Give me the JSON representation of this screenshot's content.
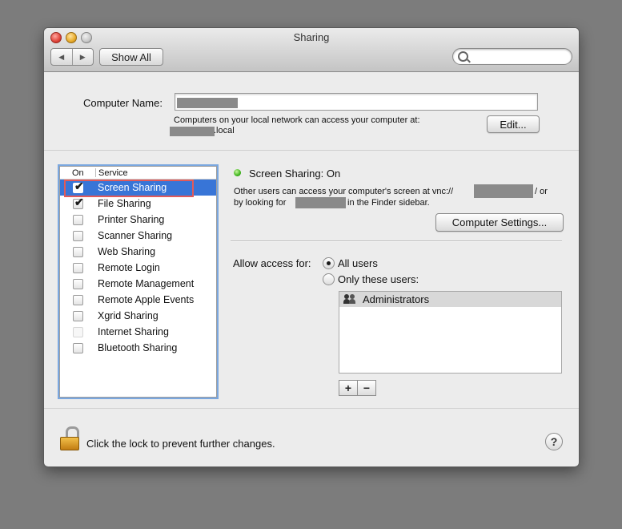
{
  "window": {
    "title": "Sharing"
  },
  "toolbar": {
    "back_glyph": "◀",
    "forward_glyph": "▶",
    "show_all_label": "Show All",
    "search_placeholder": ""
  },
  "computer_name": {
    "label": "Computer Name:",
    "value": "",
    "description": "Computers on your local network can access your computer at:",
    "address_suffix": ".local",
    "edit_label": "Edit..."
  },
  "services": {
    "header_on": "On",
    "header_service": "Service",
    "items": [
      {
        "name": "Screen Sharing",
        "checked": true,
        "selected": true,
        "enabled": true
      },
      {
        "name": "File Sharing",
        "checked": true,
        "selected": false,
        "enabled": true
      },
      {
        "name": "Printer Sharing",
        "checked": false,
        "selected": false,
        "enabled": true
      },
      {
        "name": "Scanner Sharing",
        "checked": false,
        "selected": false,
        "enabled": true
      },
      {
        "name": "Web Sharing",
        "checked": false,
        "selected": false,
        "enabled": true
      },
      {
        "name": "Remote Login",
        "checked": false,
        "selected": false,
        "enabled": true
      },
      {
        "name": "Remote Management",
        "checked": false,
        "selected": false,
        "enabled": true
      },
      {
        "name": "Remote Apple Events",
        "checked": false,
        "selected": false,
        "enabled": true
      },
      {
        "name": "Xgrid Sharing",
        "checked": false,
        "selected": false,
        "enabled": true
      },
      {
        "name": "Internet Sharing",
        "checked": false,
        "selected": false,
        "enabled": false
      },
      {
        "name": "Bluetooth Sharing",
        "checked": false,
        "selected": false,
        "enabled": true
      }
    ]
  },
  "detail": {
    "status": "Screen Sharing: On",
    "status_color": "#3fb51d",
    "info_line1_prefix": "Other users can access your computer's screen at vnc://",
    "info_line1_suffix": "/ or",
    "info_line2_prefix": "by looking for",
    "info_line2_suffix": "in the Finder sidebar.",
    "computer_settings_label": "Computer Settings...",
    "allow_label": "Allow access for:",
    "all_users_label": "All users",
    "only_users_label": "Only these users:",
    "selected_access": "all",
    "users": [
      "Administrators"
    ],
    "add_label": "+",
    "remove_label": "−"
  },
  "footer": {
    "lock_text": "Click the lock to prevent further changes.",
    "help_label": "?"
  },
  "colors": {
    "selection": "#3875d7",
    "highlight_box": "#e15a5a",
    "redaction": "#8a8a8a"
  }
}
